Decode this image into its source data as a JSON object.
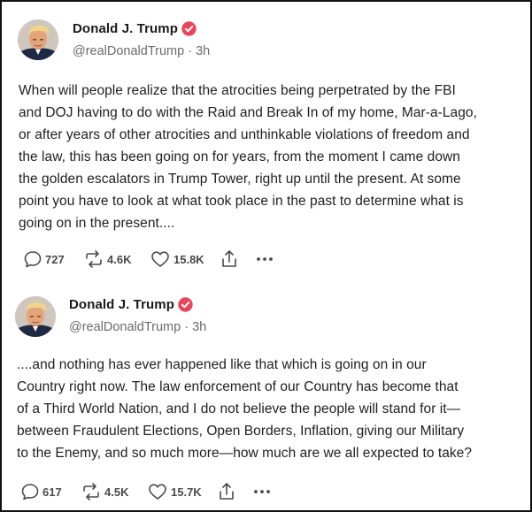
{
  "posts": [
    {
      "author": {
        "name": "Donald J. Trump",
        "handle": "@realDonaldTrump",
        "time": "3h",
        "verified": true
      },
      "lines": [
        "When will people realize that the atrocities being perpetrated by the FBI",
        "and DOJ having to do with the Raid and Break In of my home, Mar-a-Lago,",
        "or after years of other atrocities and unthinkable violations of freedom and",
        "the law, this has been going on for years, from the moment I came down",
        "the golden escalators in Trump Tower, right up until the present. At some",
        "point you have to look at what took place in the past to determine what is",
        "going on in the present...."
      ],
      "stats": {
        "replies": "727",
        "reposts": "4.6K",
        "likes": "15.8K"
      }
    },
    {
      "author": {
        "name": "Donald J. Trump",
        "handle": "@realDonaldTrump",
        "time": "3h",
        "verified": true
      },
      "lines": [
        "....and nothing has ever happened like that which is going on in our",
        "Country right now. The law enforcement of our Country has become that",
        "of a Third World Nation, and I do not believe the people will stand for it—",
        "between Fraudulent Elections, Open Borders, Inflation, giving our Military",
        "to the Enemy, and so much more—how much are we all expected to take?"
      ],
      "stats": {
        "replies": "617",
        "reposts": "4.5K",
        "likes": "15.7K"
      }
    }
  ],
  "separator": "·",
  "colors": {
    "verified_badge": "#e8465b",
    "icon": "#4a4a4a",
    "handle": "#6b6b6b",
    "text": "#1f1f1f"
  },
  "icons": [
    "avatar",
    "verified-badge-icon",
    "reply-icon",
    "repost-icon",
    "like-icon",
    "share-icon",
    "more-icon"
  ]
}
